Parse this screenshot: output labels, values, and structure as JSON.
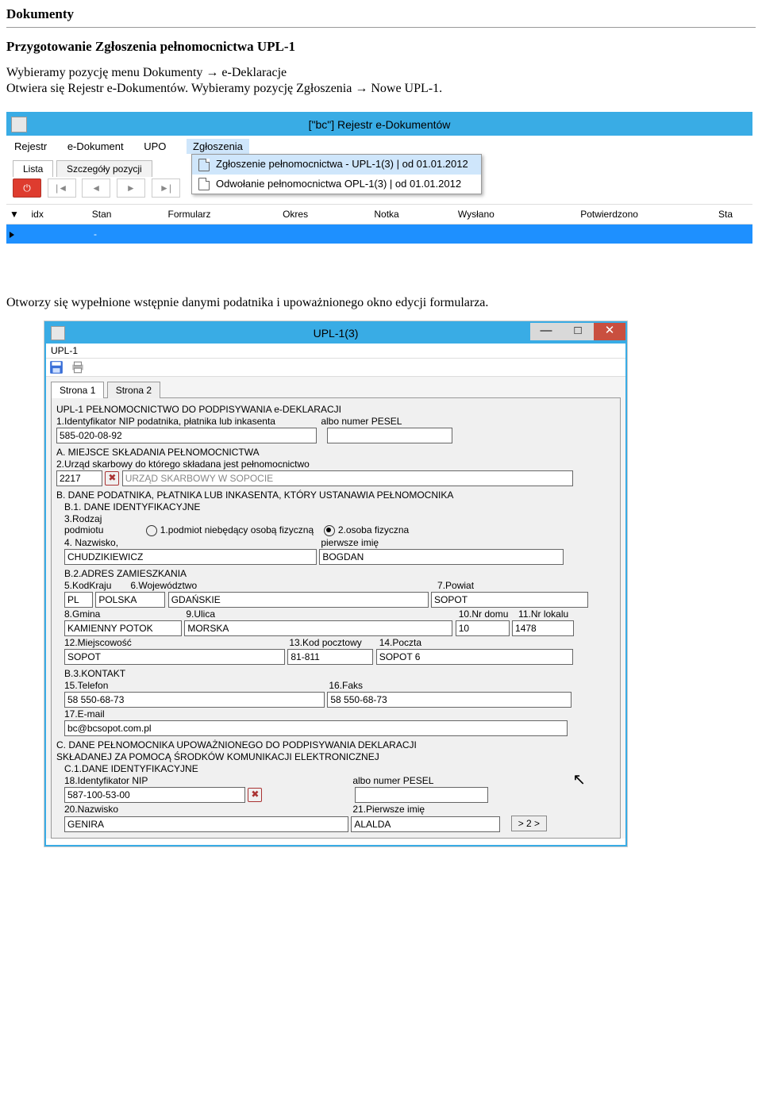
{
  "page": {
    "heading": "Dokumenty",
    "subtitle": "Przygotowanie Zgłoszenia pełnomocnictwa UPL-1",
    "para1": "Wybieramy pozycję menu Dokumenty → e-Deklaracje",
    "para2": "Otwiera się Rejestr e-Dokumentów. Wybieramy pozycję Zgłoszenia → Nowe UPL-1.",
    "para3": "Otworzy się wypełnione wstępnie danymi podatnika i upoważnionego okno edycji formularza."
  },
  "shot1": {
    "title": "[\"bc\"] Rejestr e-Dokumentów",
    "menu": {
      "rejestr": "Rejestr",
      "edok": "e-Dokument",
      "upo": "UPO",
      "zgl": "Zgłoszenia"
    },
    "tabs": {
      "lista": "Lista",
      "szcz": "Szczegóły pozycji"
    },
    "dropdown": {
      "item1": "Zgłoszenie pełnomocnictwa - UPL-1(3) | od 01.01.2012",
      "item2": "Odwołanie pełnomocnictwa  OPL-1(3) | od 01.01.2012"
    },
    "toolbar": {
      "power": "⏻",
      "first": "|◄",
      "prev": "◄",
      "next": "►",
      "last": "►|"
    },
    "grid": {
      "idx": "idx",
      "stan": "Stan",
      "form": "Formularz",
      "okres": "Okres",
      "notka": "Notka",
      "wysl": "Wysłano",
      "potw": "Potwierdzono",
      "sta": "Sta",
      "row_idx": "",
      "row_stan": "-"
    }
  },
  "shot2": {
    "title": "UPL-1(3)",
    "menu": "UPL-1",
    "tabs": {
      "s1": "Strona 1",
      "s2": "Strona 2"
    },
    "header": "UPL-1  PEŁNOMOCNICTWO DO PODPISYWANIA e-DEKLARACJI",
    "r1": {
      "lbl": "1.Identyfikator NIP podatnika, płatnika lub inkasenta",
      "lbl2": "albo numer PESEL",
      "nip": "585-020-08-92",
      "pesel": ""
    },
    "secA": {
      "title": "A. MIEJSCE SKŁADANIA PEŁNOMOCNICTWA",
      "r2lbl": "2.Urząd skarbowy do którego składana jest pełnomocnictwo",
      "code": "2217",
      "office": "URZĄD SKARBOWY W SOPOCIE"
    },
    "secB": {
      "title": "B. DANE PODATNIKA, PŁATNIKA LUB INKASENTA, KTÓRY USTANAWIA PEŁNOMOCNIKA",
      "b1": "B.1. DANE IDENTYFIKACYJNE",
      "r3lbl": "3.Rodzaj podmiotu",
      "opt1": "1.podmiot niebędący osobą fizyczną",
      "opt2": "2.osoba fizyczna",
      "r4lbl": "4. Nazwisko,",
      "r4lbl2": "pierwsze imię",
      "nazw": "CHUDZIKIEWICZ",
      "imie": "BOGDAN",
      "b2": "B.2.ADRES ZAMIESZKANIA",
      "r5": "5.KodKraju",
      "r6": "6.Województwo",
      "r7": "7.Powiat",
      "kodkraju": "PL",
      "kraj": "POLSKA",
      "woj": "GDAŃSKIE",
      "pow": "SOPOT",
      "r8": "8.Gmina",
      "r9": "9.Ulica",
      "r10": "10.Nr domu",
      "r11": "11.Nr lokalu",
      "gmina": "KAMIENNY POTOK",
      "ulica": "MORSKA",
      "nrd": "10",
      "nrl": "1478",
      "r12": "12.Miejscowość",
      "r13": "13.Kod pocztowy",
      "r14": "14.Poczta",
      "miejsc": "SOPOT",
      "kod": "81-811",
      "poczta": "SOPOT 6",
      "b3": "B.3.KONTAKT",
      "r15": "15.Telefon",
      "r16": "16.Faks",
      "tel": "58 550-68-73",
      "faks": "58 550-68-73",
      "r17": "17.E-mail",
      "email": "bc@bcsopot.com.pl"
    },
    "secC": {
      "title1": "C. DANE PEŁNOMOCNIKA UPOWAŻNIONEGO DO PODPISYWANIA DEKLARACJI",
      "title2": "SKŁADANEJ ZA POMOCĄ ŚRODKÓW KOMUNIKACJI ELEKTRONICZNEJ",
      "c1": "C.1.DANE IDENTYFIKACYJNE",
      "r18": "18.Identyfikator NIP",
      "r18b": "albo numer PESEL",
      "nip": "587-100-53-00",
      "pesel": "",
      "r20": "20.Nazwisko",
      "r21": "21.Pierwsze imię",
      "nazw": "GENIRA",
      "imie": "ALALDA",
      "nav": "> 2 >"
    }
  }
}
